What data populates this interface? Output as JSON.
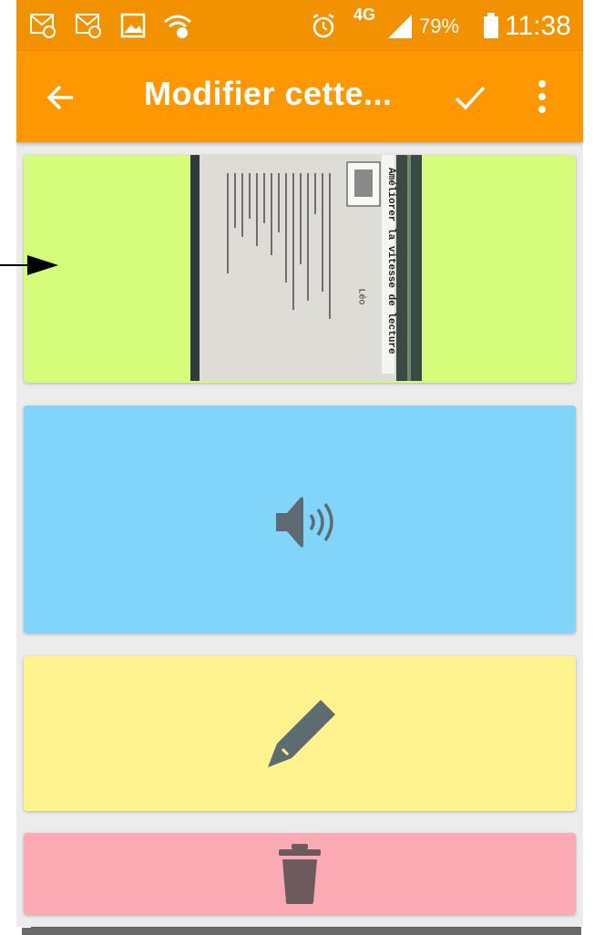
{
  "status_bar": {
    "network": "4G",
    "battery": "79%",
    "time": "11:38"
  },
  "app_bar": {
    "title": "Modifier cette...",
    "back_icon": "arrow-left-icon",
    "confirm_icon": "check-icon",
    "menu_icon": "more-vert-icon"
  },
  "cards": [
    {
      "kind": "image",
      "color": "#d4fb7a"
    },
    {
      "kind": "audio",
      "icon": "volume-icon",
      "color": "#81d4fa"
    },
    {
      "kind": "text",
      "icon": "pencil-icon",
      "color": "#fff38f"
    },
    {
      "kind": "delete",
      "icon": "trash-icon",
      "color": "#fbaab4"
    }
  ],
  "photo": {
    "heading": "Améliorer la vitesse de lecture",
    "author": "Léo"
  },
  "colors": {
    "status_bar": "#f39200",
    "app_bar": "#ff9800",
    "icon_gray": "#5f6b73"
  }
}
